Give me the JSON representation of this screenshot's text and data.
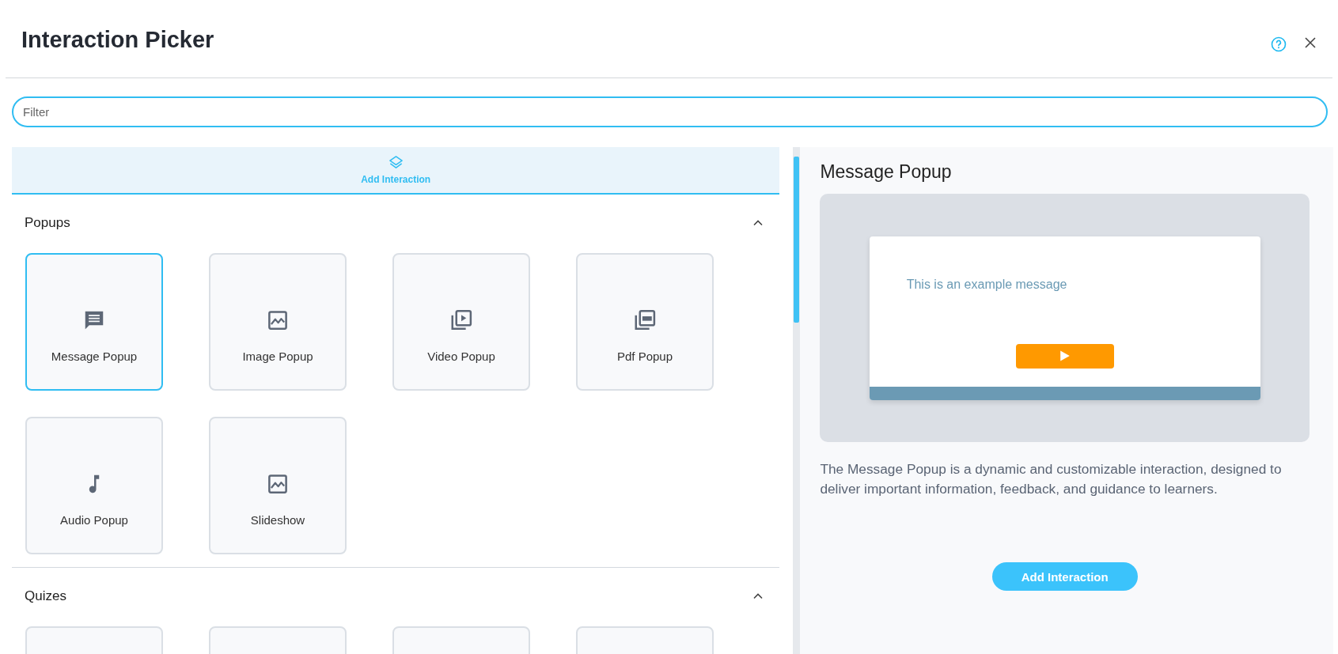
{
  "window": {
    "title": "Interaction Picker"
  },
  "filter": {
    "placeholder": "Filter"
  },
  "tabs": [
    {
      "label": "Add Interaction",
      "selected": true
    }
  ],
  "sections": [
    {
      "title": "Popups",
      "expanded": true,
      "items": [
        {
          "label": "Message Popup",
          "kind": "message",
          "selected": true
        },
        {
          "label": "Image Popup",
          "kind": "image",
          "selected": false
        },
        {
          "label": "Video Popup",
          "kind": "video",
          "selected": false
        },
        {
          "label": "Pdf Popup",
          "kind": "pdf",
          "selected": false
        },
        {
          "label": "Audio Popup",
          "kind": "audio",
          "selected": false
        },
        {
          "label": "Slideshow",
          "kind": "image",
          "selected": false
        }
      ]
    },
    {
      "title": "Quizes",
      "expanded": true,
      "items": [
        {
          "selected": false
        },
        {
          "selected": false
        },
        {
          "selected": false
        },
        {
          "selected": false
        }
      ]
    }
  ],
  "detail": {
    "title": "Message Popup",
    "preview": {
      "message": "This is an example message"
    },
    "description": "The Message Popup is a dynamic and customizable interaction, designed to deliver important information, feedback, and guidance to learners.",
    "button": "Add Interaction"
  }
}
